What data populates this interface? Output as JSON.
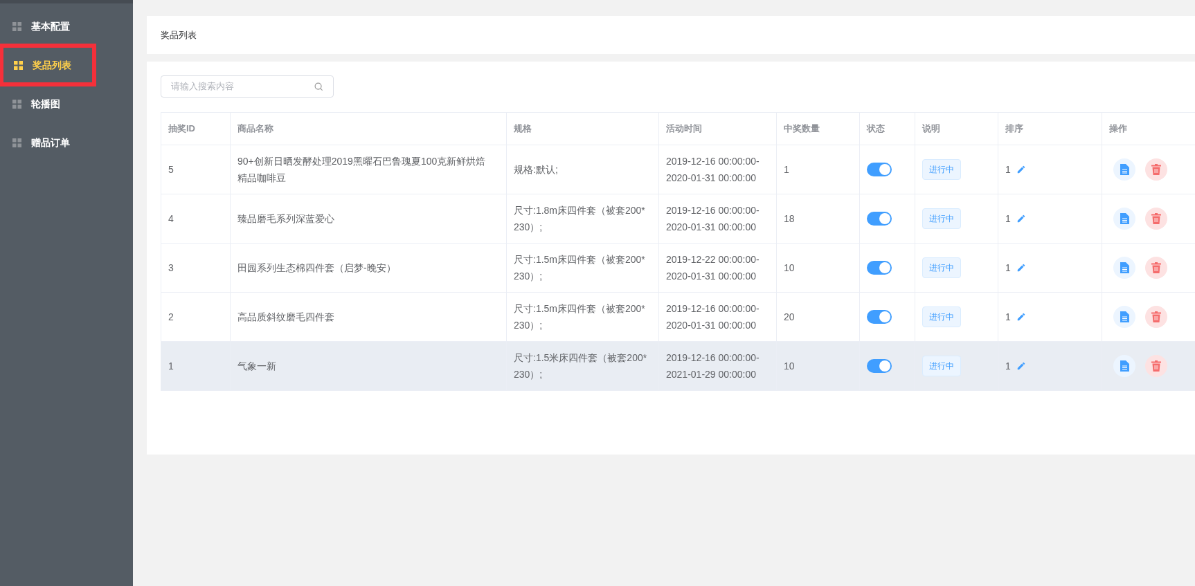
{
  "sidebar": {
    "items": [
      {
        "label": "基本配置",
        "selected": false,
        "marked": false
      },
      {
        "label": "奖品列表",
        "selected": true,
        "marked": true
      },
      {
        "label": "轮播图",
        "selected": false,
        "marked": false
      },
      {
        "label": "赠品订单",
        "selected": false,
        "marked": false
      }
    ]
  },
  "header": {
    "title": "奖品列表"
  },
  "search": {
    "placeholder": "请输入搜索内容"
  },
  "table": {
    "columns": [
      "抽奖ID",
      "商品名称",
      "规格",
      "活动时间",
      "中奖数量",
      "状态",
      "说明",
      "排序",
      "操作"
    ],
    "rows": [
      {
        "id": "5",
        "name": "90+创新日晒发酵处理2019黑曜石巴鲁瑰夏100克新鲜烘焙精品咖啡豆",
        "spec": "规格:默认;",
        "time": [
          "2019-12-16 00:00:00-",
          "2020-01-31 00:00:00"
        ],
        "count": "1",
        "on": true,
        "tag": "进行中",
        "sort": "1",
        "highlighted": false
      },
      {
        "id": "4",
        "name": "臻品磨毛系列深蓝爱心",
        "spec": "尺寸:1.8m床四件套（被套200*230）;",
        "time": [
          "2019-12-16 00:00:00-",
          "2020-01-31 00:00:00"
        ],
        "count": "18",
        "on": true,
        "tag": "进行中",
        "sort": "1",
        "highlighted": false
      },
      {
        "id": "3",
        "name": "田园系列生态棉四件套（启梦-晚安）",
        "spec": "尺寸:1.5m床四件套（被套200*230）;",
        "time": [
          "2019-12-22 00:00:00-",
          "2020-01-31 00:00:00"
        ],
        "count": "10",
        "on": true,
        "tag": "进行中",
        "sort": "1",
        "highlighted": false
      },
      {
        "id": "2",
        "name": "高品质斜纹磨毛四件套",
        "spec": "尺寸:1.5m床四件套（被套200*230）;",
        "time": [
          "2019-12-16 00:00:00-",
          "2020-01-31 00:00:00"
        ],
        "count": "20",
        "on": true,
        "tag": "进行中",
        "sort": "1",
        "highlighted": false
      },
      {
        "id": "1",
        "name": "气象一新",
        "spec": "尺寸:1.5米床四件套（被套200*230）;",
        "time": [
          "2019-12-16 00:00:00-",
          "2021-01-29 00:00:00"
        ],
        "count": "10",
        "on": true,
        "tag": "进行中",
        "sort": "1",
        "highlighted": true
      }
    ]
  }
}
